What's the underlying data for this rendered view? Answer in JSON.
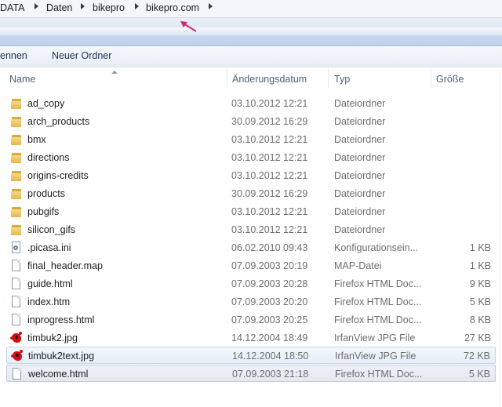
{
  "breadcrumb": [
    "DATA",
    "Daten",
    "bikepro",
    "bikepro.com"
  ],
  "toolbar": {
    "partial_button": "ennen",
    "new_folder": "Neuer Ordner"
  },
  "columns": {
    "name": "Name",
    "date": "Änderungsdatum",
    "type": "Typ",
    "size": "Größe"
  },
  "files": [
    {
      "name": "ad_copy",
      "date": "03.10.2012 12:21",
      "type": "Dateiordner",
      "size": "",
      "icon": "folder-icon"
    },
    {
      "name": "arch_products",
      "date": "30.09.2012 16:29",
      "type": "Dateiordner",
      "size": "",
      "icon": "folder-icon"
    },
    {
      "name": "bmx",
      "date": "03.10.2012 12:21",
      "type": "Dateiordner",
      "size": "",
      "icon": "folder-icon"
    },
    {
      "name": "directions",
      "date": "03.10.2012 12:21",
      "type": "Dateiordner",
      "size": "",
      "icon": "folder-icon"
    },
    {
      "name": "origins-credits",
      "date": "03.10.2012 12:21",
      "type": "Dateiordner",
      "size": "",
      "icon": "folder-icon"
    },
    {
      "name": "products",
      "date": "30.09.2012 16:29",
      "type": "Dateiordner",
      "size": "",
      "icon": "folder-icon"
    },
    {
      "name": "pubgifs",
      "date": "03.10.2012 12:21",
      "type": "Dateiordner",
      "size": "",
      "icon": "folder-icon"
    },
    {
      "name": "silicon_gifs",
      "date": "03.10.2012 12:21",
      "type": "Dateiordner",
      "size": "",
      "icon": "folder-icon"
    },
    {
      "name": ".picasa.ini",
      "date": "06.02.2010 09:43",
      "type": "Konfigurationsein...",
      "size": "1 KB",
      "icon": "config-file-icon"
    },
    {
      "name": "final_header.map",
      "date": "07.09.2003 20:19",
      "type": "MAP-Datei",
      "size": "1 KB",
      "icon": "file-icon"
    },
    {
      "name": "guide.html",
      "date": "07.09.2003 20:28",
      "type": "Firefox HTML Doc...",
      "size": "9 KB",
      "icon": "file-icon"
    },
    {
      "name": "index.htm",
      "date": "07.09.2003 20:20",
      "type": "Firefox HTML Doc...",
      "size": "5 KB",
      "icon": "file-icon"
    },
    {
      "name": "inprogress.html",
      "date": "07.09.2003 20:25",
      "type": "Firefox HTML Doc...",
      "size": "8 KB",
      "icon": "file-icon"
    },
    {
      "name": "timbuk2.jpg",
      "date": "14.12.2004 18:49",
      "type": "IrfanView JPG File",
      "size": "27 KB",
      "icon": "irfanview-jpg-icon"
    },
    {
      "name": "timbuk2text.jpg",
      "date": "14.12.2004 18:50",
      "type": "IrfanView JPG File",
      "size": "72 KB",
      "icon": "irfanview-jpg-icon"
    },
    {
      "name": "welcome.html",
      "date": "07.09.2003 21:18",
      "type": "Firefox HTML Doc...",
      "size": "5 KB",
      "icon": "file-icon"
    }
  ]
}
